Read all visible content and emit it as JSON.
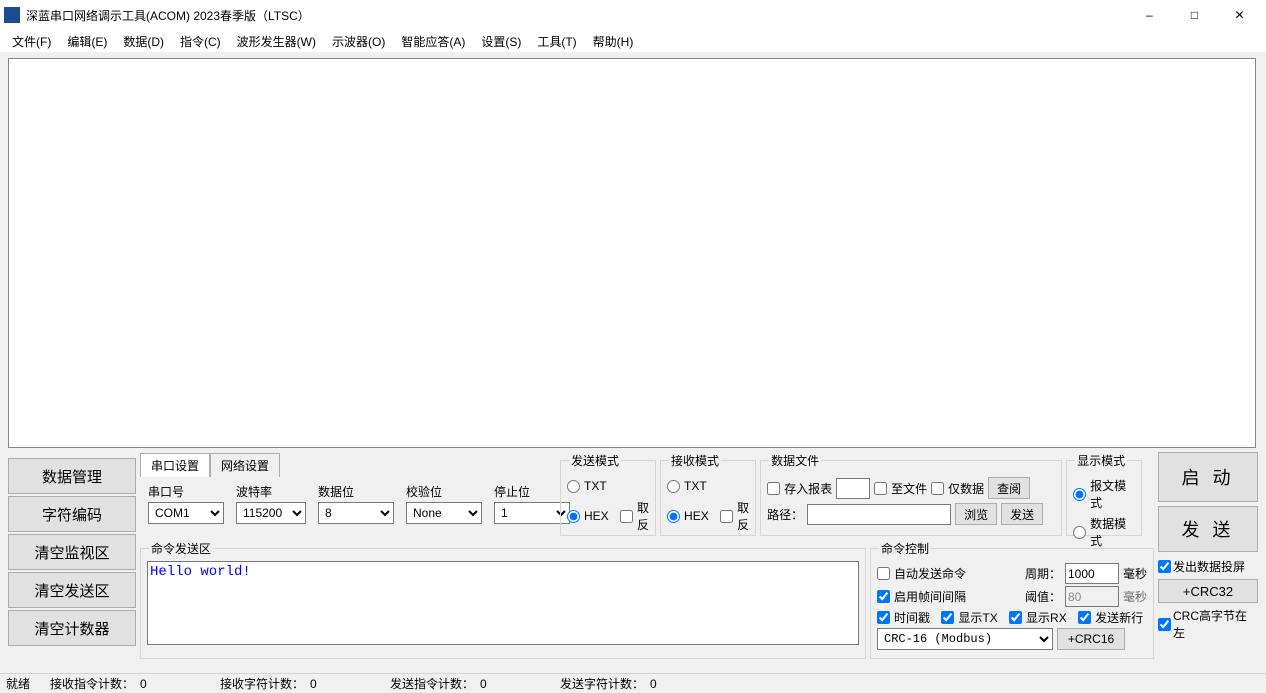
{
  "window": {
    "title": "深蓝串口网络调示工具(ACOM) 2023春季版（LTSC）"
  },
  "menu": {
    "file": "文件(F)",
    "edit": "编辑(E)",
    "data": "数据(D)",
    "cmd": "指令(C)",
    "wave": "波形发生器(W)",
    "osc": "示波器(O)",
    "ai": "智能应答(A)",
    "set": "设置(S)",
    "tool": "工具(T)",
    "help": "帮助(H)"
  },
  "leftbtn": {
    "datamgr": "数据管理",
    "enc": "字符编码",
    "clrmon": "清空监视区",
    "clrsend": "清空发送区",
    "clrcnt": "清空计数器"
  },
  "tabs": {
    "serial": "串口设置",
    "net": "网络设置"
  },
  "port": {
    "portlbl": "串口号",
    "portval": "COM1",
    "baudlbl": "波特率",
    "baudval": "115200",
    "datalbl": "数据位",
    "dataval": "8",
    "checklbl": "校验位",
    "checkval": "None",
    "stoplbl": "停止位",
    "stopval": "1"
  },
  "sendmode": {
    "title": "发送模式",
    "txt": "TXT",
    "hex": "HEX",
    "inv": "取反"
  },
  "recvmode": {
    "title": "接收模式",
    "txt": "TXT",
    "hex": "HEX",
    "inv": "取反"
  },
  "file": {
    "title": "数据文件",
    "save": "存入报表",
    "tofile": "至文件",
    "onlydata": "仅数据",
    "view": "查阅",
    "pathlbl": "路径：",
    "browse": "浏览",
    "send": "发送"
  },
  "disp": {
    "title": "显示模式",
    "msg": "报文模式",
    "data": "数据模式"
  },
  "right": {
    "start": "启 动",
    "send": "发 送",
    "crc32": "+CRC32"
  },
  "checks": {
    "proj": "发出数据投屏",
    "crchi": "CRC高字节在左"
  },
  "sendarea": {
    "title": "命令发送区",
    "text": "Hello world!"
  },
  "ctrl": {
    "title": "命令控制",
    "auto": "自动发送命令",
    "periodlbl": "周期：",
    "periodval": "1000",
    "periodunit": "毫秒",
    "enframe": "启用帧间间隔",
    "threshlbl": "阈值：",
    "threshval": "80",
    "threshunit": "毫秒",
    "ts": "时间戳",
    "showtx": "显示TX",
    "showrx": "显示RX",
    "newline": "发送新行",
    "crcalg": "CRC-16 (Modbus)",
    "crcbtn": "+CRC16"
  },
  "status": {
    "ready": "就绪",
    "rxcmdlbl": "接收指令计数：",
    "rxcmdval": "0",
    "rxchrlbl": "接收字符计数：",
    "rxchrval": "0",
    "txcmdlbl": "发送指令计数：",
    "txcmdval": "0",
    "txchrlbl": "发送字符计数：",
    "txchrval": "0"
  }
}
